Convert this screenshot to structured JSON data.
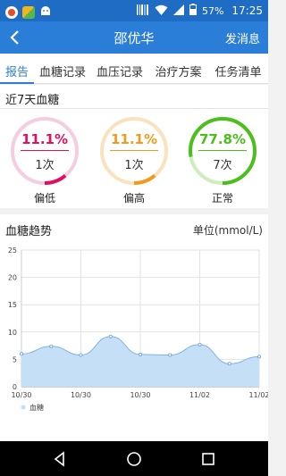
{
  "status_bar": {
    "time": "17:25",
    "battery": "57%",
    "icons": [
      "browser-app-icon",
      "photos-app-icon",
      "android-icon",
      "barcode-icon",
      "wifi-icon",
      "signal-icon",
      "battery-icon"
    ]
  },
  "header": {
    "title": "邵优华",
    "action": "发消息"
  },
  "tabs": [
    {
      "label": "报告",
      "active": true
    },
    {
      "label": "血糖记录",
      "active": false
    },
    {
      "label": "血压记录",
      "active": false
    },
    {
      "label": "治疗方案",
      "active": false
    },
    {
      "label": "任务清单",
      "active": false
    }
  ],
  "summary": {
    "title": "近7天血糖",
    "items": [
      {
        "percent": "11.1%",
        "fraction": 0.111,
        "count": "1次",
        "label": "偏低",
        "color": "#e0105f",
        "track": "#f5cde0"
      },
      {
        "percent": "11.1%",
        "fraction": 0.111,
        "count": "1次",
        "label": "偏高",
        "color": "#f29a1b",
        "track": "#fbe2bf"
      },
      {
        "percent": "77.8%",
        "fraction": 0.778,
        "count": "7次",
        "label": "正常",
        "color": "#4cbf1c",
        "track": "#cfedbd"
      }
    ]
  },
  "trend": {
    "title": "血糖趋势",
    "unit": "单位(mmol/L)"
  },
  "chart_data": {
    "type": "area",
    "title": "",
    "xlabel": "",
    "ylabel": "",
    "ylim": [
      0,
      25
    ],
    "yticks": [
      "0",
      "5",
      "10",
      "15",
      "20",
      "25"
    ],
    "xticks": [
      "10/30",
      "10/30",
      "10/30",
      "11/02",
      "11/02"
    ],
    "grid": true,
    "legend_position": "bottom-left",
    "series": [
      {
        "name": "血糖",
        "color": "#7fb2e5",
        "fill": "#c5dff7",
        "values": [
          6.0,
          7.4,
          5.8,
          9.2,
          5.9,
          5.8,
          7.7,
          4.2,
          5.5
        ]
      }
    ]
  },
  "nav_bar": {
    "buttons": [
      "back-nav-icon",
      "home-nav-icon",
      "recents-nav-icon"
    ]
  }
}
